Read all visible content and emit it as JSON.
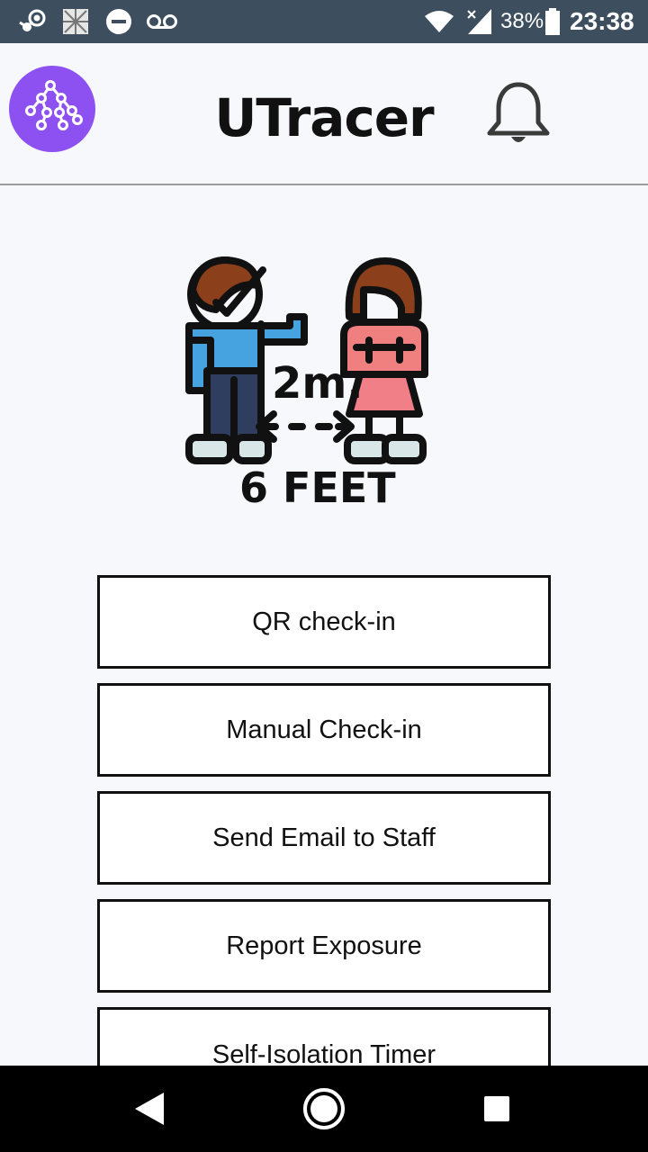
{
  "status_bar": {
    "battery_percent": "38%",
    "time": "23:38",
    "icons": [
      "steam-icon",
      "image-icon",
      "do-not-disturb-icon",
      "voicemail-icon",
      "wifi-icon",
      "signal-icon",
      "battery-icon"
    ]
  },
  "header": {
    "title": "UTracer",
    "logo_icon": "network-logo-icon",
    "notification_icon": "bell-icon"
  },
  "illustration": {
    "distance_metric": "2m.",
    "distance_imperial": "6 FEET"
  },
  "actions": [
    {
      "label": "QR check-in"
    },
    {
      "label": "Manual Check-in"
    },
    {
      "label": "Send Email to Staff"
    },
    {
      "label": "Report Exposure"
    },
    {
      "label": "Self-Isolation Timer"
    }
  ],
  "nav_bar": {
    "icons": [
      "back-icon",
      "home-icon",
      "recents-icon"
    ]
  },
  "colors": {
    "status_bar": "#3d4f5f",
    "background": "#f7f8fc",
    "logo": "#8d51f2",
    "nav_bar": "#000000"
  }
}
